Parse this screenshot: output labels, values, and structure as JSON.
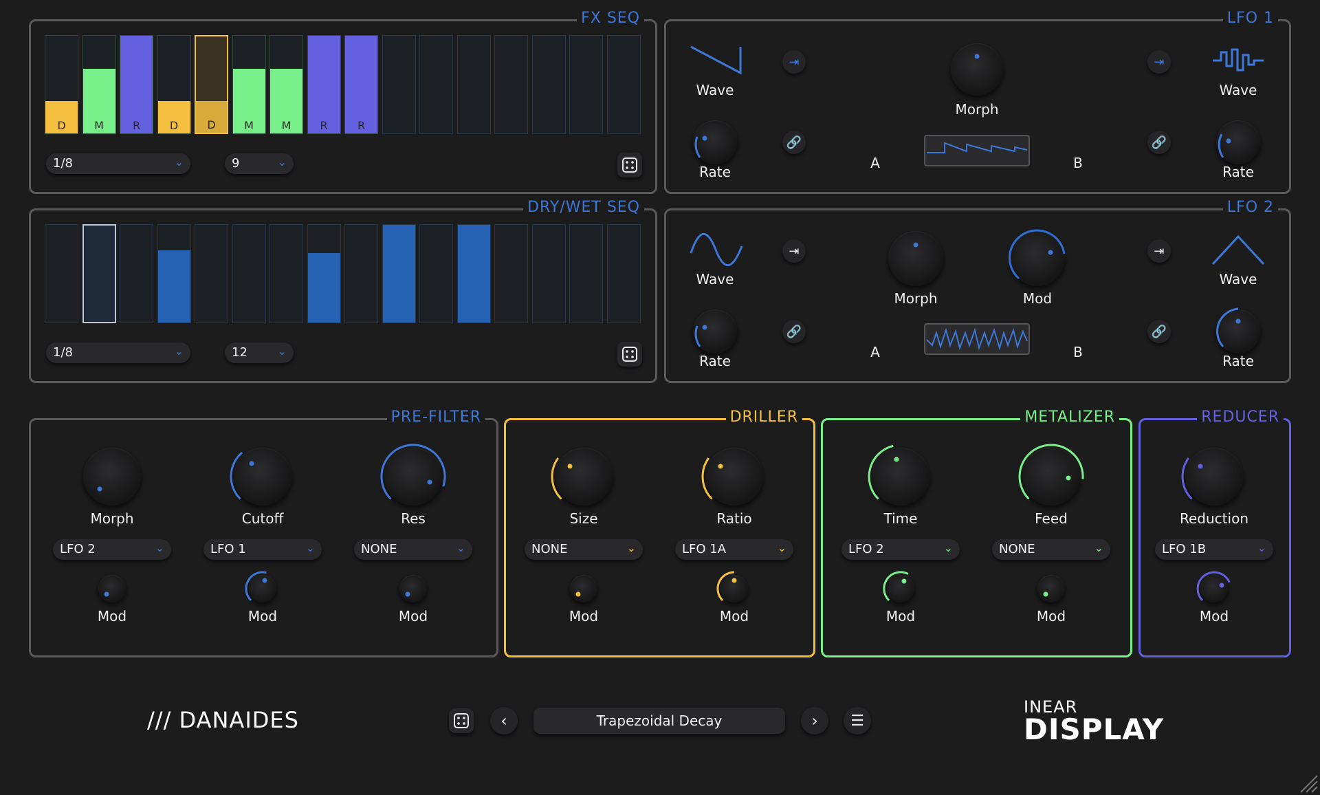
{
  "colors": {
    "blue": "#3d78d8",
    "yellow": "#f5c040",
    "green": "#78f08a",
    "purple": "#6560e0",
    "border": "#5a5a5c",
    "seqblue": "#2562b4"
  },
  "fxseq": {
    "title": "FX SEQ",
    "steps": [
      {
        "label": "D",
        "type": "driller",
        "level": 0.33
      },
      {
        "label": "M",
        "type": "metalizer",
        "level": 0.66
      },
      {
        "label": "R",
        "type": "reducer",
        "level": 1.0
      },
      {
        "label": "D",
        "type": "driller",
        "level": 0.33
      },
      {
        "label": "D",
        "type": "driller",
        "level": 0.33,
        "selected": true
      },
      {
        "label": "M",
        "type": "metalizer",
        "level": 0.66
      },
      {
        "label": "M",
        "type": "metalizer",
        "level": 0.66
      },
      {
        "label": "R",
        "type": "reducer",
        "level": 1.0
      },
      {
        "label": "R",
        "type": "reducer",
        "level": 1.0
      }
    ],
    "total_steps": 16,
    "rate": "1/8",
    "length": "9"
  },
  "drywet": {
    "title": "DRY/WET SEQ",
    "levels": [
      0,
      0,
      0,
      0.74,
      0,
      0,
      0,
      0.71,
      0,
      1,
      0,
      1
    ],
    "selected": 1,
    "total_steps": 16,
    "rate": "1/8",
    "length": "12"
  },
  "lfo1": {
    "title": "LFO 1",
    "wave_a": "Wave",
    "morph": "Morph",
    "wave_b": "Wave",
    "rate_a": "Rate",
    "rate_b": "Rate",
    "a": "A",
    "b": "B"
  },
  "lfo2": {
    "title": "LFO 2",
    "wave_a": "Wave",
    "morph": "Morph",
    "mod": "Mod",
    "wave_b": "Wave",
    "rate_a": "Rate",
    "rate_b": "Rate",
    "a": "A",
    "b": "B"
  },
  "prefilter": {
    "title": "PRE-FILTER",
    "knobs": [
      {
        "label": "Morph",
        "source": "LFO 2",
        "mod": "Mod"
      },
      {
        "label": "Cutoff",
        "source": "LFO 1",
        "mod": "Mod"
      },
      {
        "label": "Res",
        "source": "NONE",
        "mod": "Mod"
      }
    ]
  },
  "driller": {
    "title": "DRILLER",
    "knobs": [
      {
        "label": "Size",
        "source": "NONE",
        "mod": "Mod"
      },
      {
        "label": "Ratio",
        "source": "LFO 1A",
        "mod": "Mod"
      }
    ]
  },
  "metalizer": {
    "title": "METALIZER",
    "knobs": [
      {
        "label": "Time",
        "source": "LFO 2",
        "mod": "Mod"
      },
      {
        "label": "Feed",
        "source": "NONE",
        "mod": "Mod"
      }
    ]
  },
  "reducer": {
    "title": "REDUCER",
    "knobs": [
      {
        "label": "Reduction",
        "source": "LFO 1B",
        "mod": "Mod"
      }
    ]
  },
  "footer": {
    "brand": "/// DANAIDES",
    "preset": "Trapezoidal Decay",
    "vendor_top": "INEAR",
    "vendor_bottom": "DISPLAY"
  }
}
